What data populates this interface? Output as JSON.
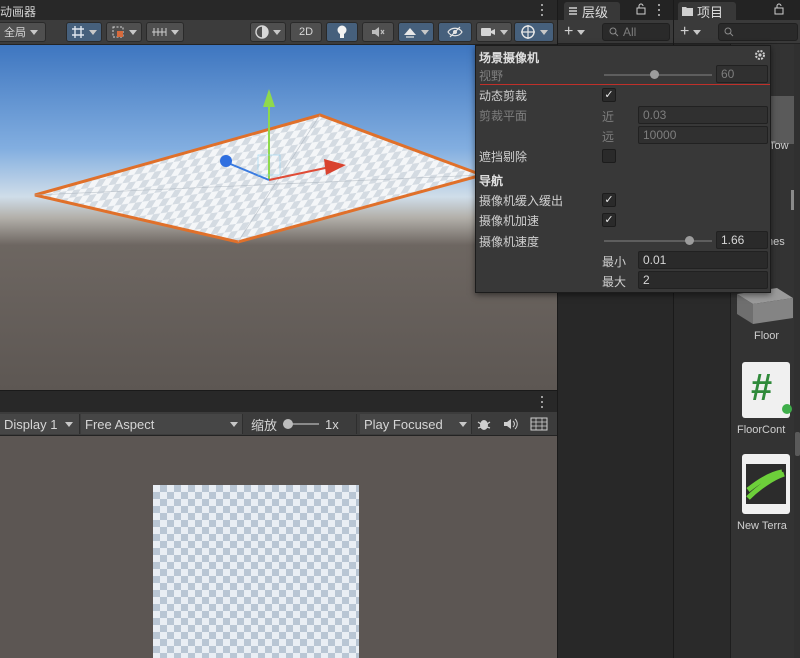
{
  "scene": {
    "tab_label": "动画器",
    "toolbar": {
      "global_label": "全局",
      "mode_2d_label": "2D"
    }
  },
  "camera_panel": {
    "title": "场景摄像机",
    "fov_label": "视野",
    "fov_value": "60",
    "dynamic_clipping_label": "动态剪裁",
    "dynamic_clipping_checked": "✓",
    "clipping_planes_label": "剪裁平面",
    "near_label": "近",
    "near_value": "0.03",
    "far_label": "远",
    "far_value": "10000",
    "occlusion_culling_label": "遮挡剔除",
    "navigation_header": "导航",
    "easing_label": "摄像机缓入缓出",
    "easing_checked": "✓",
    "acceleration_label": "摄像机加速",
    "acceleration_checked": "✓",
    "speed_label": "摄像机速度",
    "speed_value": "1.66",
    "min_label": "最小",
    "min_value": "0.01",
    "max_label": "最大",
    "max_value": "2"
  },
  "game": {
    "display_label": "Display 1",
    "aspect_label": "Free Aspect",
    "scale_label": "缩放",
    "scale_value": "1x",
    "play_mode_label": "Play Focused"
  },
  "hierarchy": {
    "tab_label": "层级",
    "search_placeholder": "All"
  },
  "project": {
    "tab_label": "项目",
    "assets": [
      {
        "label": "Tow"
      },
      {
        "label": "nes"
      },
      {
        "label": "Floor"
      },
      {
        "label": "FloorCont"
      },
      {
        "label": "New Terra"
      }
    ]
  }
}
